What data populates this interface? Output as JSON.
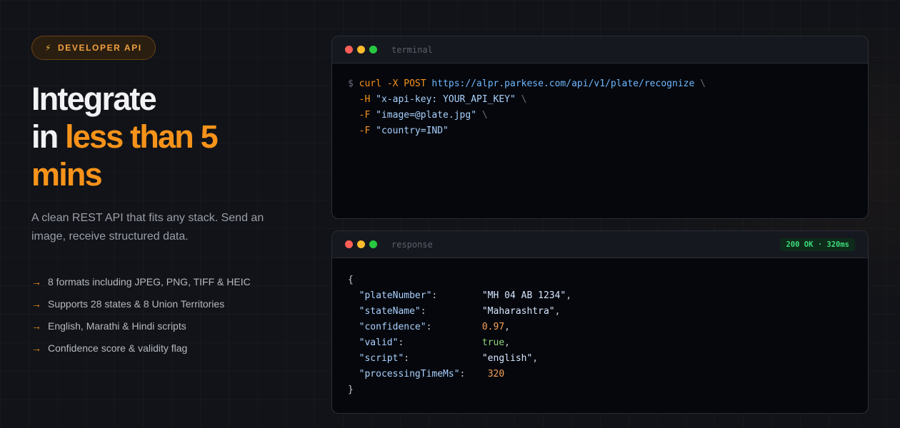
{
  "badge": {
    "icon": "lightning-icon",
    "label": "DEVELOPER API"
  },
  "headline": {
    "line1": "Integrate",
    "line2_plain": "in",
    "line2_accent": "less than 5",
    "line3_accent": "mins"
  },
  "subtitle": "A clean REST API that fits any stack. Send an image, receive structured data.",
  "features": [
    "8 formats including JPEG, PNG, TIFF & HEIC",
    "Supports 28 states & 8 Union Territories",
    "English, Marathi & Hindi scripts",
    "Confidence score & validity flag"
  ],
  "feature_arrow": "→",
  "terminal": {
    "title": "terminal",
    "prompt": "$",
    "command": "curl",
    "method_flag": "-X",
    "method": "POST",
    "url": "https://alpr.parkese.com/api/v1/plate/recognize",
    "continuation": "\\",
    "lines": [
      {
        "flag": "-H",
        "arg": "\"x-api-key: YOUR_API_KEY\"",
        "cont": "\\"
      },
      {
        "flag": "-F",
        "arg": "\"image=@plate.jpg\"",
        "cont": "\\"
      },
      {
        "flag": "-F",
        "arg": "\"country=IND\"",
        "cont": ""
      }
    ]
  },
  "response": {
    "title": "response",
    "status": "200 OK · 320ms",
    "open_brace": "{",
    "close_brace": "}",
    "fields": [
      {
        "key": "\"plateNumber\"",
        "value": "\"MH 04 AB 1234\"",
        "type": "string",
        "comma": ","
      },
      {
        "key": "\"stateName\"",
        "value": "\"Maharashtra\"",
        "type": "string",
        "comma": ","
      },
      {
        "key": "\"confidence\"",
        "value": "0.97",
        "type": "number",
        "comma": ","
      },
      {
        "key": "\"valid\"",
        "value": "true",
        "type": "bool",
        "comma": ","
      },
      {
        "key": "\"script\"",
        "value": "\"english\"",
        "type": "string",
        "comma": ","
      },
      {
        "key": "\"processingTimeMs\"",
        "value": "320",
        "type": "number",
        "comma": ""
      }
    ]
  },
  "colors": {
    "accent": "#f7931a",
    "status_green": "#3ddc7a",
    "background": "#111318"
  }
}
